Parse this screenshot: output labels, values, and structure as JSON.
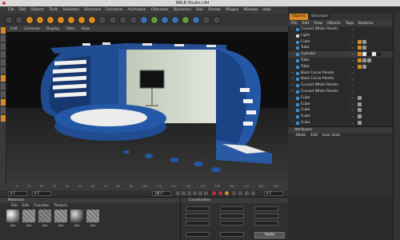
{
  "window": {
    "title": "BBLB Studio.c4d"
  },
  "menu": [
    "File",
    "Edit",
    "Objects",
    "Tools",
    "Selection",
    "Structure",
    "Functions",
    "Animation",
    "Character",
    "Dynamics",
    "Hair",
    "Render",
    "Plugins",
    "Window",
    "Help"
  ],
  "viewport_menu": [
    "Edit",
    "Cameras",
    "Display",
    "Filter",
    "View"
  ],
  "timeline": {
    "ticks": [
      "0",
      "10",
      "20",
      "30",
      "40",
      "50",
      "60",
      "70",
      "80",
      "90",
      "100",
      "110",
      "120",
      "130",
      "140",
      "150",
      "160",
      "170",
      "180",
      "190"
    ],
    "frame_left": "0 F",
    "frame_start": "0 F",
    "frame_end": "180 F",
    "frame_right": "0 F"
  },
  "materials": {
    "title": "Materials",
    "menu": [
      "File",
      "Edit",
      "Function",
      "Texture"
    ],
    "swatches": [
      {
        "label": "Mat",
        "color": "#9a9a9a"
      },
      {
        "label": "Mat",
        "color": "#8b8b8b"
      },
      {
        "label": "Mat",
        "color": "#7c7c7c"
      },
      {
        "label": "Mat",
        "color": "#888888"
      },
      {
        "label": "Mat",
        "color": "#6d6d6d"
      },
      {
        "label": "Mat",
        "color": "#999999"
      },
      {
        "label": "Mat",
        "color": "#808080"
      }
    ]
  },
  "coordinates": {
    "title": "Coordinates",
    "apply_label": "Apply"
  },
  "right_panel": {
    "tabs": [
      "Objects",
      "Structure"
    ],
    "menu": [
      "File",
      "Edit",
      "View",
      "Objects",
      "Tags",
      "Bookma"
    ],
    "objects": [
      "Curved White Panels",
      "Light",
      "Cube",
      "Tube",
      "Cylinder",
      "Tube",
      "Tube",
      "Back Curve Panels",
      "Back Curve Panels",
      "Curved White Panels",
      "Curved White Panels",
      "Cube",
      "Cube",
      "Cube",
      "Cube",
      "Cube"
    ],
    "attributes_title": "Attributes",
    "attributes_menu": [
      "Mode",
      "Edit",
      "User Data"
    ]
  },
  "colors": {
    "accent": "#d98a23",
    "set_blue": "#2a5aa3",
    "floor": "#2a2a2a"
  }
}
